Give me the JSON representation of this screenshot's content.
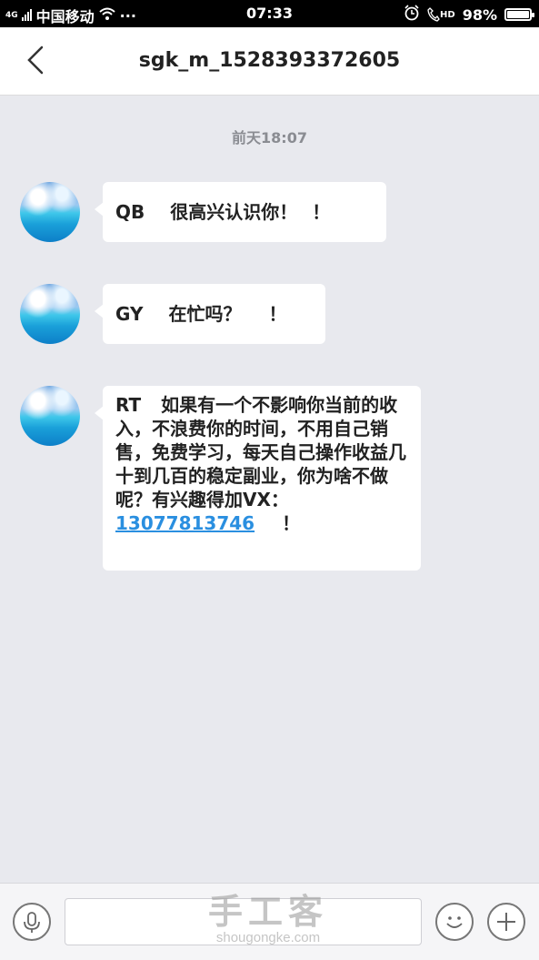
{
  "status_bar": {
    "network": "4G",
    "carrier": "中国移动",
    "more": "···",
    "time": "07:33",
    "hd": "HD",
    "battery": "98%",
    "battery_level": 0.98
  },
  "header": {
    "title": "sgk_m_1528393372605"
  },
  "chat": {
    "timestamp": "前天18:07",
    "messages": [
      {
        "prefix": "QB",
        "text": "很高兴认识你！",
        "suffix": "！"
      },
      {
        "prefix": "GY",
        "text": "在忙吗？",
        "suffix": "！"
      },
      {
        "prefix": "RT",
        "text": "如果有一个不影响你当前的收入，不浪费你的时间，不用自己销售，免费学习，每天自己操作收益几十到几百的稳定副业，你为啥不做呢？有兴趣得加VX：",
        "link": "13077813746",
        "suffix": "！"
      }
    ]
  },
  "bottom_bar": {
    "input_value": "",
    "watermark_title": "手工客",
    "watermark_url": "shougongke.com"
  }
}
